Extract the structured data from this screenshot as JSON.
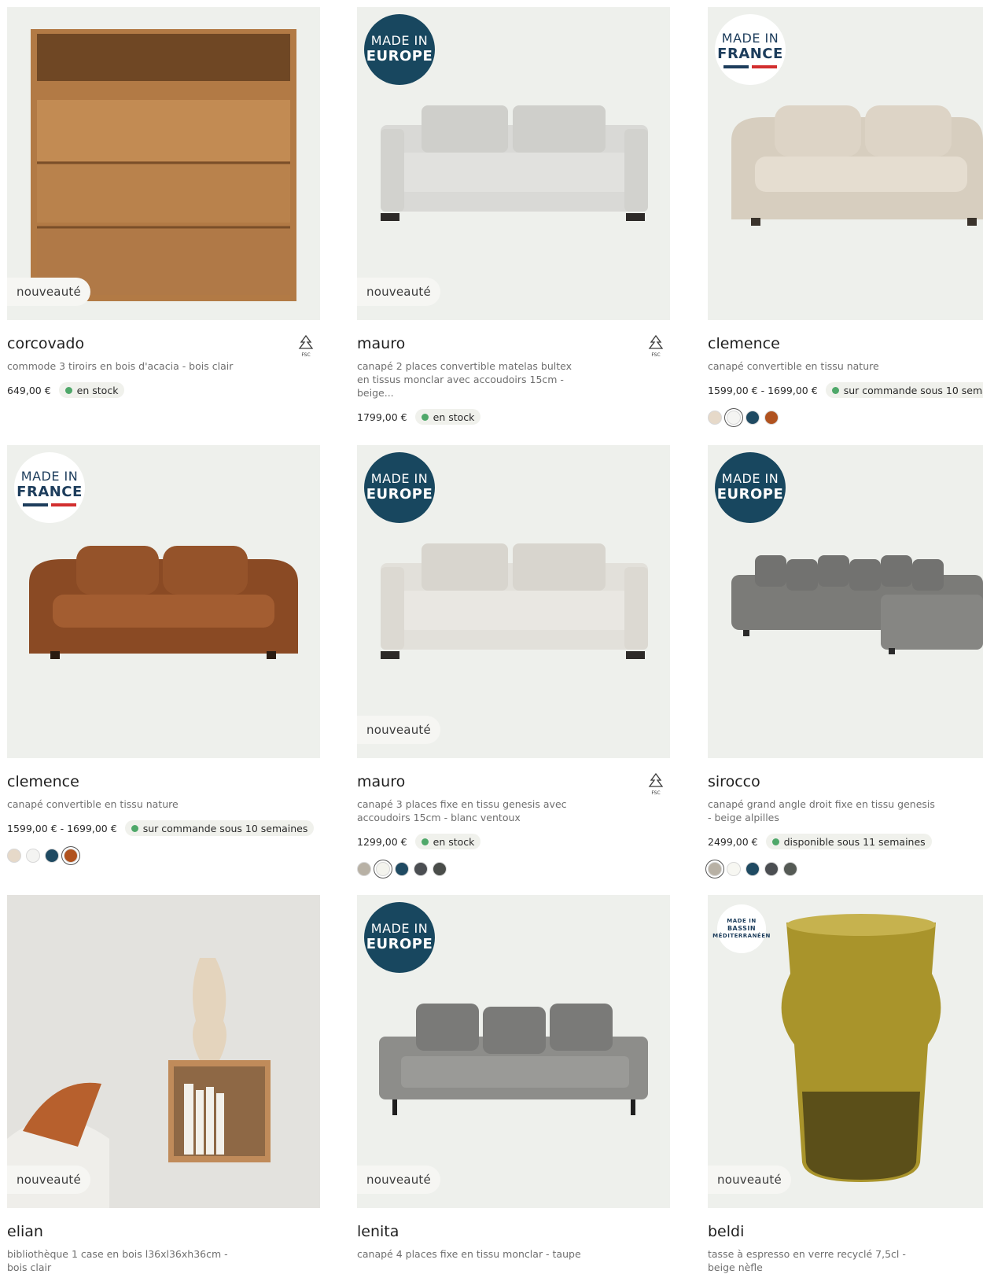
{
  "labels": {
    "new_badge": "nouveauté"
  },
  "made_in": {
    "europe": [
      "MADE IN",
      "EUROPE"
    ],
    "france": [
      "MADE IN",
      "FRANCE"
    ],
    "bassin": [
      "MADE IN",
      "BASSIN",
      "MÉDITERRANÉEN"
    ]
  },
  "products": [
    {
      "name": "corcovado",
      "desc": "commode 3 tiroirs en bois d'acacia - bois clair",
      "price": "649,00 €",
      "stock": "en stock"
    },
    {
      "name": "mauro",
      "desc": "canapé 2 places convertible matelas bultex en tissus monclar avec accoudoirs 15cm - beige...",
      "price": "1799,00 €",
      "stock": "en stock"
    },
    {
      "name": "clemence",
      "desc": "canapé convertible en tissu nature",
      "price": "1599,00 € - 1699,00 €",
      "stock": "sur commande sous 10 semaines"
    },
    {
      "name": "clemence",
      "desc": "canapé convertible en tissu nature",
      "price": "1599,00 € - 1699,00 €",
      "stock": "sur commande sous 10 semaines"
    },
    {
      "name": "mauro",
      "desc": "canapé 3 places fixe en tissu genesis avec accoudoirs 15cm - blanc ventoux",
      "price": "1299,00 €",
      "stock": "en stock"
    },
    {
      "name": "sirocco",
      "desc": "canapé grand angle droit fixe en tissu genesis - beige alpilles",
      "price": "2499,00 €",
      "stock": "disponible sous 11 semaines"
    },
    {
      "name": "elian",
      "desc": "bibliothèque 1 case en bois l36xl36xh36cm - bois clair",
      "price": "",
      "stock": ""
    },
    {
      "name": "lenita",
      "desc": "canapé 4 places fixe en tissu monclar - taupe",
      "price": "",
      "stock": ""
    },
    {
      "name": "beldi",
      "desc": "tasse à espresso en verre recyclé 7,5cl - beige nèfle",
      "price": "",
      "stock": ""
    }
  ],
  "swatches": {
    "clemence_a": [
      "#e6d9c9",
      "#f4f4f2",
      "#1f4a62",
      "#b0521f"
    ],
    "clemence_b": [
      "#e6d9c9",
      "#f4f4f2",
      "#1f4a62",
      "#b0521f"
    ],
    "mauro_b": [
      "#b8b1a5",
      "#f4f4ee",
      "#1f4a62",
      "#4b4e52",
      "#4a4d4a"
    ],
    "sirocco": [
      "#b8b1a5",
      "#f7f7f2",
      "#1f4a62",
      "#4b4e52",
      "#555a55"
    ]
  },
  "colors": {
    "accent_dark": "#18475f",
    "stock_green": "#4fa86a",
    "card_bg": "#eef0ec"
  }
}
